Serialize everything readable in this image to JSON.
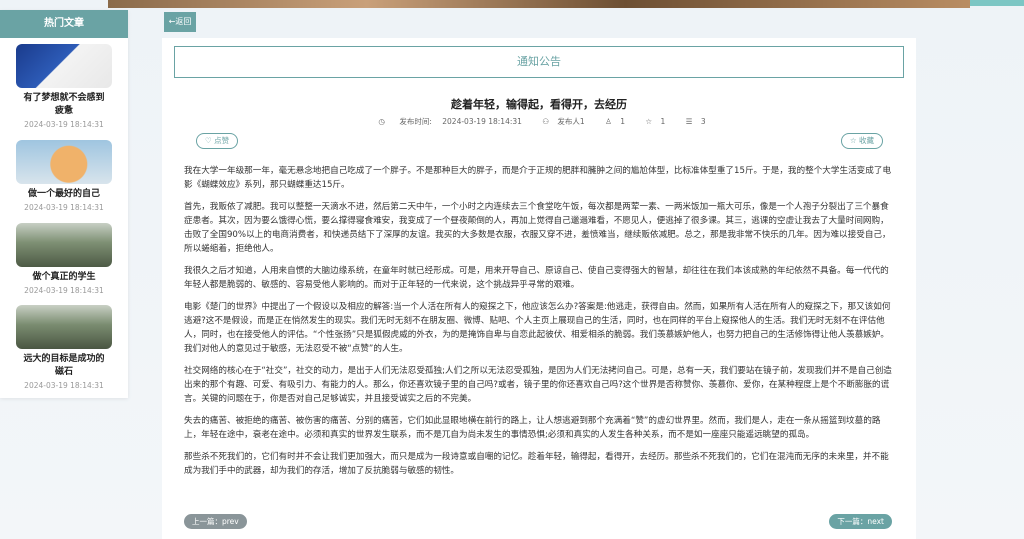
{
  "sidebar": {
    "title": "热门文章",
    "items": [
      {
        "title": "有了梦想就不会感到疲惫",
        "date": "2024-03-19 18:14:31",
        "thumb": "product-ad-image"
      },
      {
        "title": "做一个最好的自己",
        "date": "2024-03-19 18:14:31",
        "thumb": "corgi-dog-image"
      },
      {
        "title": "做个真正的学生",
        "date": "2024-03-19 18:14:31",
        "thumb": "people-with-dog-image"
      },
      {
        "title": "远大的目标是成功的磁石",
        "date": "2024-03-19 18:14:31",
        "thumb": "people-with-dog-image"
      }
    ]
  },
  "back_label": "返回",
  "notice_label": "通知公告",
  "article": {
    "title": "趁着年轻，输得起，看得开，去经历",
    "publish_label": "发布时间:",
    "publish_time": "2024-03-19 18:14:31",
    "author": "发布人1",
    "likes": "1",
    "stars": "1",
    "views": "3",
    "paragraphs": [
      "我在大学一年级那一年，毫无悬念地把自己吃成了一个胖子。不是那种巨大的胖子，而是介于正规的肥胖和臃肿之间的尴尬体型，比标准体型重了15斤。于是，我的整个大学生活变成了电影《蝴蝶效应》系列，那只蝴蝶重达15斤。",
      "首先，我贩依了减肥。我可以整整一天滴水不进，然后第二天中午，一个小时之内连续去三个食堂吃午饭，每次都是两荤一素、一两米饭加一瓶大可乐，像是一个人孢子分裂出了三个暴食症患者。其次，因为要么饿得心慌，要么撑得寝食难安，我变成了一个昼夜颠倒的人，再加上觉得自己邋遢难看，不愿见人，便逃掉了很多课。其三，逃课的空虚让我去了大量时间网购，击败了全国90%以上的电商消费者，和快递员结下了深厚的友谊。我买的大多数是衣服，衣服又穿不进，羞愤难当，继续贩依减肥。总之，那是我非常不快乐的几年。因为难以接受自己，所以蜷缩着，拒绝他人。",
      "我很久之后才知道，人用来自惯的大脑边缘系统，在童年时就已经形成。可是，用来开导自己、原谅自己、使自己变得强大的智慧，却往往在我们本该成熟的年纪依然不具备。每一代代的年轻人都是脆弱的、敏感的、容易受他人影响的。而对于正年轻的一代来说，这个挑战异乎寻常的艰难。",
      "电影《楚门的世界》中提出了一个假设以及相应的解答:当一个人活在所有人的窥探之下，他应该怎么办?答案是:他逃走，获得自由。然而，如果所有人活在所有人的窥探之下，那又该如何逃避?这不是假设，而是正在悄然发生的现实。我们无时无刻不在朋友圈、微博、贴吧、个人主页上展现自己的生活，同时，也在同样的平台上窥探他人的生活。我们无时无刻不在评估他人，同时，也在接受他人的评估。“个性张扬”只是狐假虎威的外衣，为的是掩饰自卑与自恋此起彼伏、相爱相杀的脆弱。我们羡慕嫉妒他人，也努力把自己的生活修饰得让他人羡慕嫉妒。我们对他人的意见过于敏感，无法忍受不被“点赞”的人生。",
      "社交网络的核心在于“社交”，社交的动力，是出于人们无法忍受孤独;人们之所以无法忍受孤独，是因为人们无法拷问自己。可是，总有一天，我们要站在镜子前，发现我们并不是自己创造出来的那个有趣、可爱、有吸引力、有能力的人。那么，你还喜欢镜子里的自己吗?或者，镜子里的你还喜欢自己吗?这个世界是否称赞你、羡慕你、爱你，在某种程度上是个不断膨胀的谎言。关键的问题在于，你是否对自己足够诚实，并且接受诚实之后的不完美。",
      "失去的痛苦、被拒绝的痛苦、被伤害的痛苦、分别的痛苦，它们如此显眼地横在前行的路上，让人想逃避到那个充满着“赞”的虚幻世界里。然而，我们是人，走在一条从摇篮到坟墓的路上，年轻在途中，衰老在途中。必须和真实的世界发生联系，而不是兀自为尚未发生的事情恐惧;必须和真实的人发生各种关系，而不是如一座座只能遥远眺望的孤岛。",
      "那些杀不死我们的，它们有时并不会让我们更加强大，而只是成为一段诗意或自嘲的记忆。趁着年轻，输得起，看得开，去经历。那些杀不死我们的，它们在混沌而无序的未来里，并不能成为我们手中的武器，却为我们的存活，增加了反抗脆弱与敏感的韧性。"
    ]
  },
  "buttons": {
    "like": "点赞",
    "favorite": "收藏",
    "prev": "上一篇：prev",
    "next": "下一篇：next"
  },
  "colors": {
    "accent": "#6aa3a4",
    "muted": "#8a9599"
  }
}
